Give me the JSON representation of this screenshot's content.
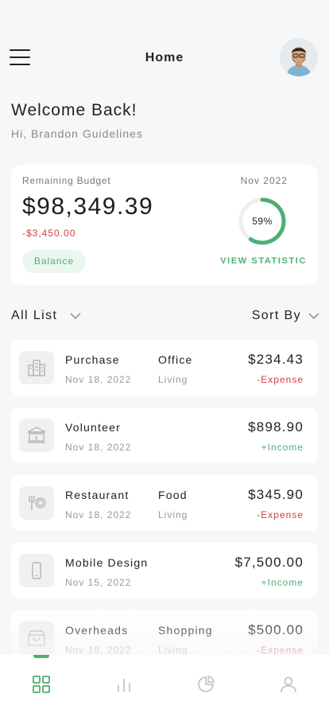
{
  "header": {
    "title": "Home",
    "menu_icon": "hamburger-menu-icon",
    "avatar": "user-avatar"
  },
  "welcome": {
    "title": "Welcome Back!",
    "subtitle": "Hi, Brandon Guidelines"
  },
  "budget": {
    "label": "Remaining Budget",
    "amount": "$98,349.39",
    "change": "-$3,450.00",
    "balance_label": "Balance",
    "month": "Nov 2022",
    "progress_label": "59%",
    "progress": 0.59,
    "view_statistic": "VIEW STATISTIC"
  },
  "filters": {
    "list_label": "All List",
    "sort_label": "Sort By"
  },
  "transactions": [
    {
      "title": "Purchase",
      "date": "Nov 18, 2022",
      "category": "Office",
      "subcategory": "Living",
      "amount": "$234.43",
      "type": "-Expense",
      "icon": "building-icon"
    },
    {
      "title": "Volunteer",
      "date": "Nov 18, 2022",
      "category": "",
      "subcategory": "",
      "amount": "$898.90",
      "type": "+Income",
      "icon": "bank-icon"
    },
    {
      "title": "Restaurant",
      "date": "Nov 18, 2022",
      "category": "Food",
      "subcategory": "Living",
      "amount": "$345.90",
      "type": "-Expense",
      "icon": "utensils-icon"
    },
    {
      "title": "Mobile Design",
      "date": "Nov 15, 2022",
      "category": "",
      "subcategory": "",
      "amount": "$7,500.00",
      "type": "+Income",
      "icon": "smartphone-icon"
    },
    {
      "title": "Overheads",
      "date": "Nov 18, 2022",
      "category": "Shopping",
      "subcategory": "Living",
      "amount": "$500.00",
      "type": "-Expense",
      "icon": "shopping-bag-icon"
    }
  ],
  "bottom_nav": [
    {
      "icon": "grid-icon",
      "active": true
    },
    {
      "icon": "bar-chart-icon",
      "active": false
    },
    {
      "icon": "pie-chart-icon",
      "active": false
    },
    {
      "icon": "user-icon",
      "active": false
    }
  ],
  "colors": {
    "accent": "#4caf73",
    "expense": "#d83a3a",
    "background": "#f7f7f7",
    "card": "#ffffff"
  }
}
